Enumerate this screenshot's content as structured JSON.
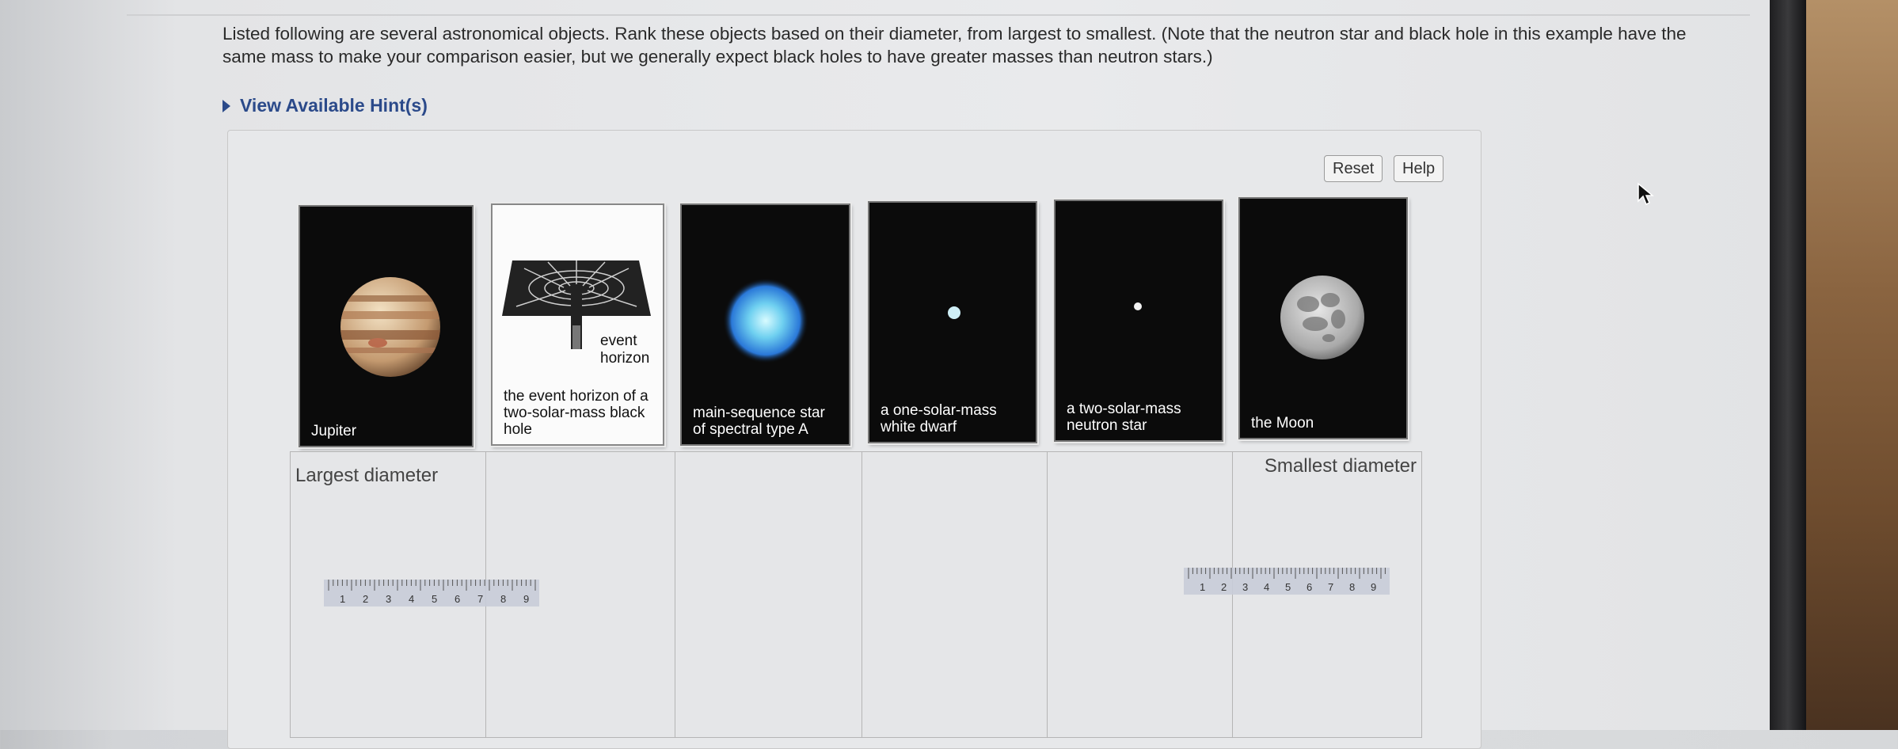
{
  "question": "Listed following are several astronomical objects. Rank these objects based on their diameter, from largest to smallest. (Note that the neutron star and black hole in this example have the same mass to make your comparison easier, but we generally expect black holes to have greater masses than neutron stars.)",
  "hint_link": "View Available Hint(s)",
  "buttons": {
    "reset": "Reset",
    "help": "Help"
  },
  "cards": [
    {
      "label": "Jupiter"
    },
    {
      "label": "the event horizon of a two-solar-mass black hole",
      "diagram_label": "event horizon"
    },
    {
      "label": "main-sequence star of spectral type A"
    },
    {
      "label": "a one-solar-mass white dwarf"
    },
    {
      "label": "a two-solar-mass neutron star"
    },
    {
      "label": "the Moon"
    }
  ],
  "ranking": {
    "largest": "Largest diameter",
    "smallest": "Smallest diameter"
  },
  "ruler_numbers": [
    "1",
    "2",
    "3",
    "4",
    "5",
    "6",
    "7",
    "8",
    "9"
  ]
}
